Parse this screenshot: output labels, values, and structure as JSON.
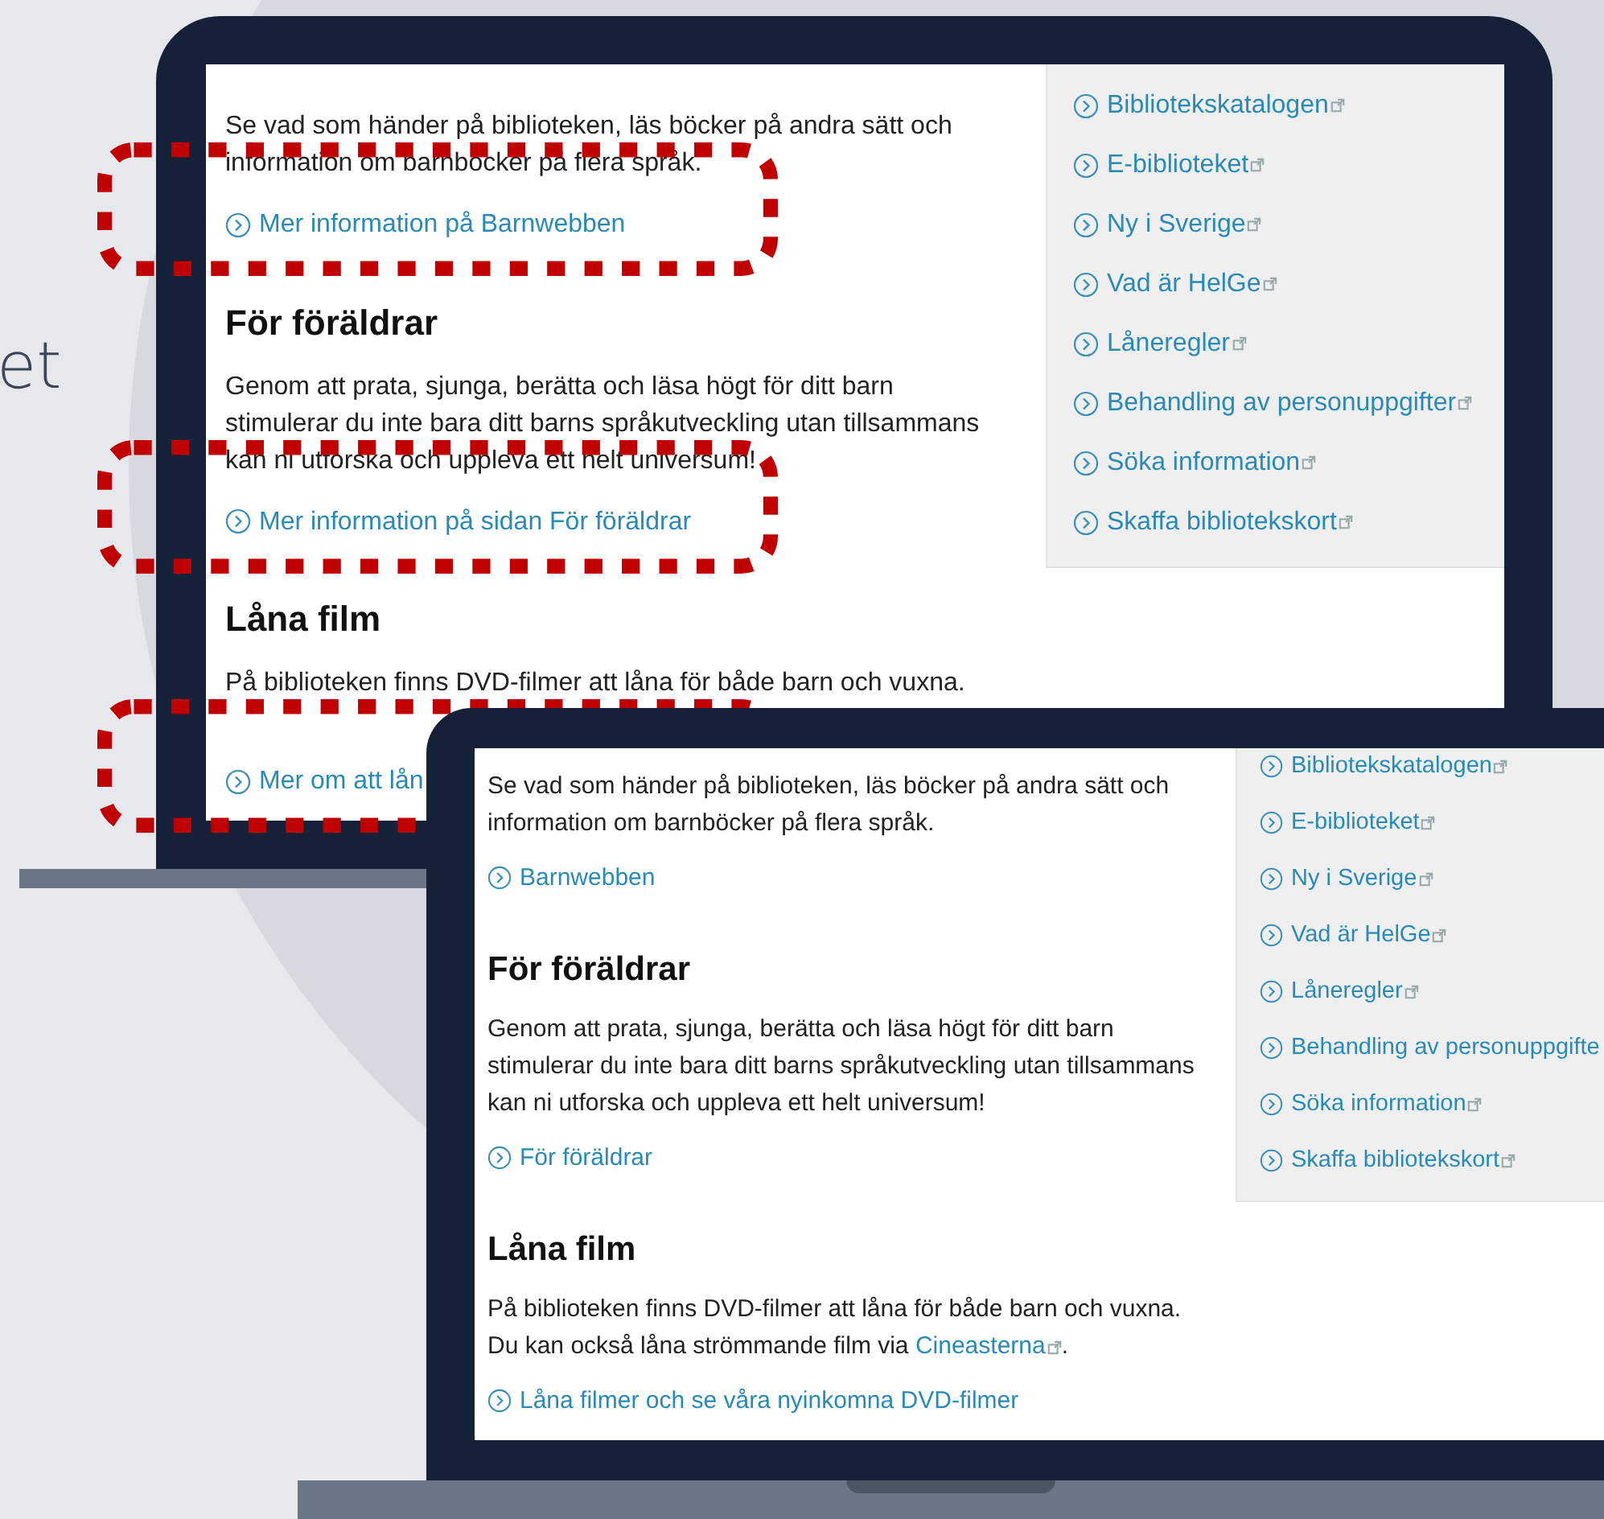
{
  "background_text": "et",
  "laptops": [
    {
      "kind": "back",
      "sections": [
        {
          "paragraph": {
            "lines": [
              "Se vad som händer på biblioteken, läs böcker på andra sätt och",
              "information om barnböcker på flera språk."
            ]
          },
          "link": "Mer information på Barnwebben",
          "highlighted": true
        },
        {
          "heading": "För föräldrar",
          "paragraph": {
            "lines": [
              "Genom att prata, sjunga, berätta och läsa högt för ditt barn",
              "stimulerar du inte bara ditt barns språkutveckling utan tillsammans",
              "kan ni utforska och uppleva ett helt universum!"
            ]
          },
          "link": "Mer information på sidan För föräldrar",
          "highlighted": true
        },
        {
          "heading": "Låna film",
          "paragraph": {
            "lines": [
              "På biblioteken finns DVD-filmer att låna för både barn och vuxna."
            ]
          },
          "link": "Mer om att lån",
          "highlighted": true
        }
      ],
      "sidebar_links": [
        {
          "label": "Bibliotekskatalogen",
          "external": true
        },
        {
          "label": "E-biblioteket",
          "external": true
        },
        {
          "label": "Ny i Sverige",
          "external": true
        },
        {
          "label": "Vad är HelGe",
          "external": true
        },
        {
          "label": "Låneregler",
          "external": true
        },
        {
          "label": "Behandling av personuppgifter",
          "external": true
        },
        {
          "label": "Söka information",
          "external": true
        },
        {
          "label": "Skaffa bibliotekskort",
          "external": true
        }
      ]
    },
    {
      "kind": "front",
      "sections": [
        {
          "paragraph": {
            "lines": [
              "Se vad som händer på biblioteken, läs böcker på andra sätt och",
              "information om barnböcker på flera språk."
            ]
          },
          "link": "Barnwebben"
        },
        {
          "heading": "För föräldrar",
          "paragraph": {
            "lines": [
              "Genom att prata, sjunga, berätta och läsa högt för ditt barn",
              "stimulerar du inte bara ditt barns språkutveckling utan tillsammans",
              "kan ni utforska och uppleva ett helt universum!"
            ]
          },
          "link": "För föräldrar"
        },
        {
          "heading": "Låna film",
          "paragraph": {
            "lines": [
              "På biblioteken finns DVD-filmer att låna för både barn och vuxna.",
              "Du kan också låna strömmande film via"
            ],
            "link": "Cineasterna",
            "after": "."
          },
          "link": "Låna filmer och se våra nyinkomna DVD-filmer"
        }
      ],
      "sidebar_links": [
        {
          "label": "Bibliotekskatalogen",
          "external": true
        },
        {
          "label": "E-biblioteket",
          "external": true
        },
        {
          "label": "Ny i Sverige",
          "external": true
        },
        {
          "label": "Vad är HelGe",
          "external": true
        },
        {
          "label": "Låneregler",
          "external": true
        },
        {
          "label": "Behandling av personuppgifte",
          "external": false
        },
        {
          "label": "Söka information",
          "external": true
        },
        {
          "label": "Skaffa bibliotekskort",
          "external": true
        }
      ]
    }
  ]
}
